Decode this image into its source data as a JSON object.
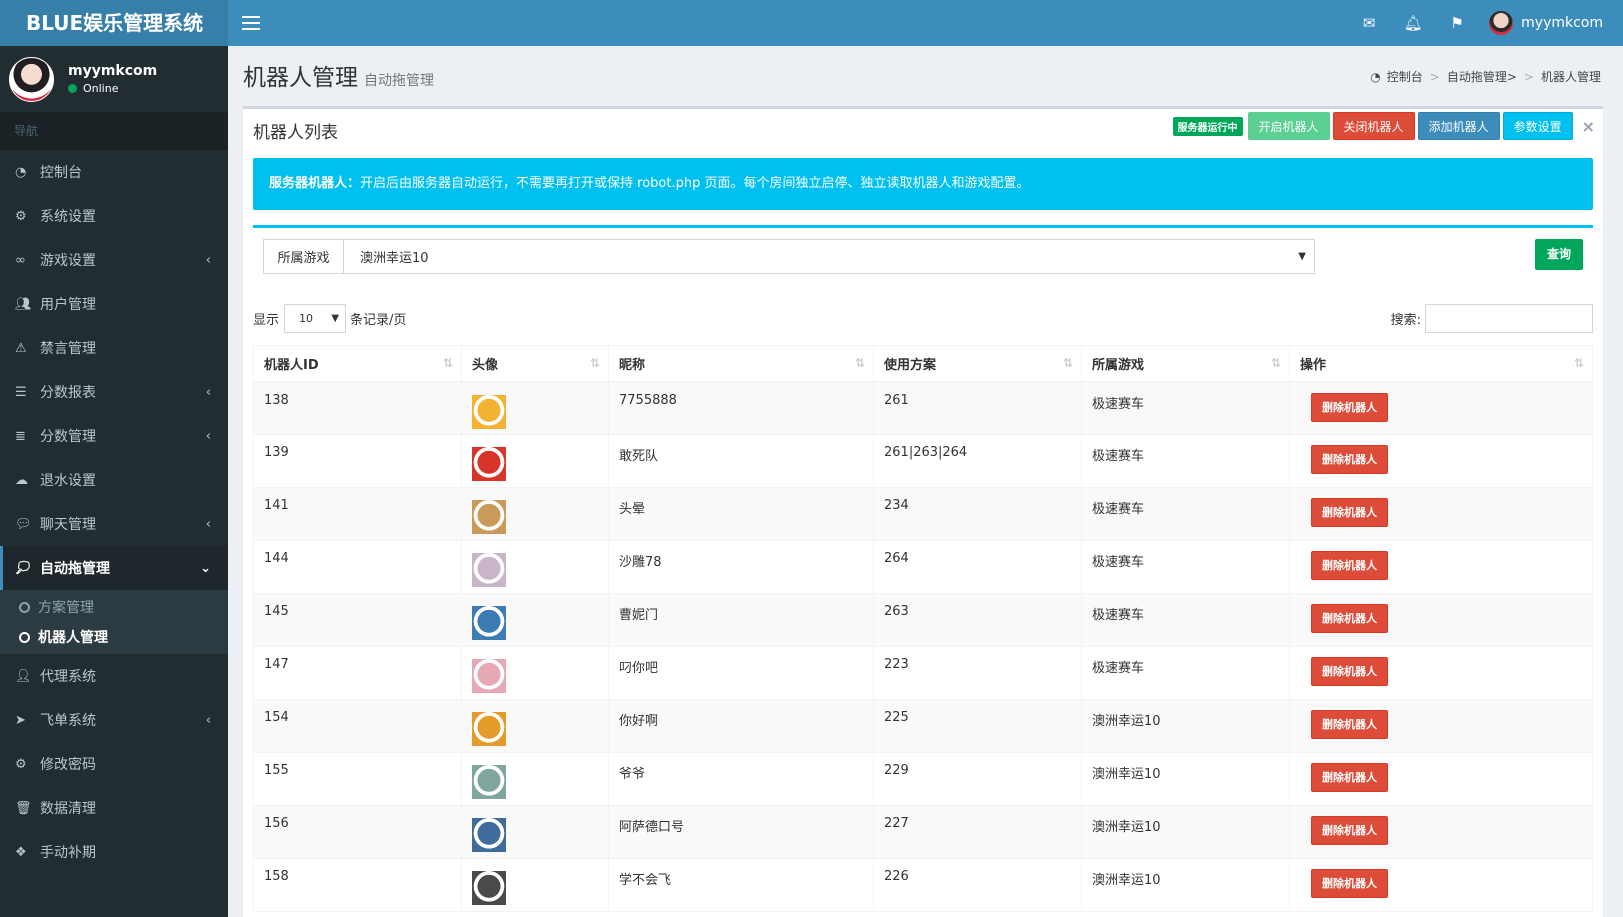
{
  "app": {
    "logo": "BLUE娱乐管理系统"
  },
  "header": {
    "user_name": "myymkcom",
    "icons": [
      "envelope-icon",
      "bell-icon",
      "flag-icon"
    ]
  },
  "sidebar": {
    "user_name": "myymkcom",
    "status": "Online",
    "nav_header": "导航",
    "items": [
      {
        "label": "控制台",
        "icon": "dashboard-icon"
      },
      {
        "label": "系统设置",
        "icon": "gears-icon"
      },
      {
        "label": "游戏设置",
        "icon": "gamepad-icon",
        "chevron": "‹"
      },
      {
        "label": "用户管理",
        "icon": "users-icon"
      },
      {
        "label": "禁言管理",
        "icon": "warning-icon"
      },
      {
        "label": "分数报表",
        "icon": "list-icon",
        "chevron": "‹"
      },
      {
        "label": "分数管理",
        "icon": "database-icon",
        "chevron": "‹"
      },
      {
        "label": "退水设置",
        "icon": "cloud-download-icon"
      },
      {
        "label": "聊天管理",
        "icon": "comments-icon",
        "chevron": "‹"
      },
      {
        "label": "自动拖管理",
        "icon": "commenting-icon",
        "chevron": "⌄"
      },
      {
        "label": "代理系统",
        "icon": "user-plus-icon"
      },
      {
        "label": "飞单系统",
        "icon": "paper-plane-icon",
        "chevron": "‹"
      },
      {
        "label": "修改密码",
        "icon": "cog-icon"
      },
      {
        "label": "数据清理",
        "icon": "trash-icon"
      },
      {
        "label": "手动补期",
        "icon": "cubes-icon"
      }
    ],
    "subitems": [
      {
        "label": "方案管理"
      },
      {
        "label": "机器人管理"
      }
    ]
  },
  "content": {
    "title": "机器人管理",
    "subtitle": "自动拖管理",
    "breadcrumb": [
      "控制台",
      "自动拖管理>",
      "机器人管理"
    ]
  },
  "box": {
    "title": "机器人列表",
    "status_label": "服务器运行中",
    "buttons": {
      "start": "开启机器人",
      "stop": "关闭机器人",
      "add": "添加机器人",
      "params": "参数设置"
    },
    "close": "×",
    "callout_bold": "服务器机器人：",
    "callout_text": "开启后由服务器自动运行，不需要再打开或保持 robot.php 页面。每个房间独立启停、独立读取机器人和游戏配置。",
    "filter_label": "所属游戏",
    "filter_value": "澳洲幸运10",
    "query": "查询",
    "show": "显示",
    "page_len": "10",
    "per_page": "条记录/页",
    "search": "搜索:"
  },
  "table": {
    "headers": [
      "机器人ID",
      "头像",
      "昵称",
      "使用方案",
      "所属游戏",
      "操作"
    ],
    "delete_label": "删除机器人",
    "rows": [
      {
        "id": "138",
        "nick": "7755888",
        "plan": "261",
        "game": "极速赛车",
        "color": "#f3b230"
      },
      {
        "id": "139",
        "nick": "敢死队",
        "plan": "261|263|264",
        "game": "极速赛车",
        "color": "#d8342a"
      },
      {
        "id": "141",
        "nick": "头晕",
        "plan": "234",
        "game": "极速赛车",
        "color": "#c99a5a"
      },
      {
        "id": "144",
        "nick": "沙雕78",
        "plan": "264",
        "game": "极速赛车",
        "color": "#c9b6c9"
      },
      {
        "id": "145",
        "nick": "曹妮门",
        "plan": "263",
        "game": "极速赛车",
        "color": "#3d7bb3"
      },
      {
        "id": "147",
        "nick": "叼你吧",
        "plan": "223",
        "game": "极速赛车",
        "color": "#e6a8b4"
      },
      {
        "id": "154",
        "nick": "你好啊",
        "plan": "225",
        "game": "澳洲幸运10",
        "color": "#e39b2a"
      },
      {
        "id": "155",
        "nick": "爷爷",
        "plan": "229",
        "game": "澳洲幸运10",
        "color": "#7fa7a0"
      },
      {
        "id": "156",
        "nick": "阿萨德口号",
        "plan": "227",
        "game": "澳洲幸运10",
        "color": "#3f6c9a"
      },
      {
        "id": "158",
        "nick": "学不会飞",
        "plan": "226",
        "game": "澳洲幸运10",
        "color": "#4a4a4a"
      }
    ]
  }
}
